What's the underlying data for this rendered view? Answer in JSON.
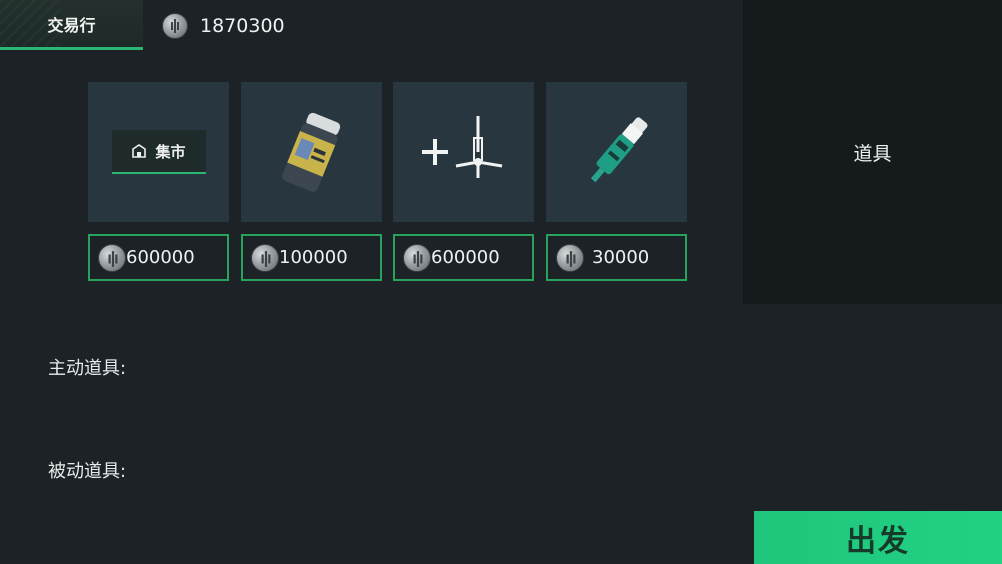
{
  "header": {
    "active_tab": "交易行",
    "balance": "1870300",
    "currency_icon": "silver-coin-icon"
  },
  "items": [
    {
      "kind": "market",
      "badge_label": "集市",
      "badge_icon": "shop-icon",
      "price": "600000"
    },
    {
      "kind": "pill-bottle",
      "icon": "pill-bottle-icon",
      "price": "100000"
    },
    {
      "kind": "syringe-plus",
      "icon": "syringe-icon",
      "price": "600000"
    },
    {
      "kind": "injector",
      "icon": "injector-icon",
      "price": "30000"
    }
  ],
  "right_panel": {
    "title": "道具"
  },
  "sections": {
    "active_label": "主动道具:",
    "passive_label": "被动道具:"
  },
  "actions": {
    "depart_label": "出发"
  },
  "colors": {
    "accent_green": "#27a35e",
    "button_green": "#22d184",
    "card_bg": "#283640",
    "page_bg": "#1c2226"
  }
}
